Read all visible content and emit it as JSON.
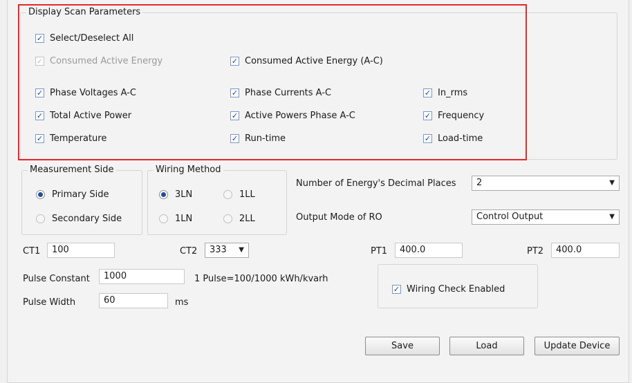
{
  "scan_params": {
    "title": "Display Scan Parameters",
    "select_all": "Select/Deselect All",
    "items": {
      "consumed_active_energy": "Consumed Active Energy",
      "consumed_active_energy_ac": "Consumed Active Energy (A-C)",
      "phase_voltages": "Phase Voltages A-C",
      "phase_currents": "Phase Currents A-C",
      "in_rms": "In_rms",
      "total_active_power": "Total Active Power",
      "active_powers_phase": "Active Powers Phase A-C",
      "frequency": "Frequency",
      "temperature": "Temperature",
      "run_time": "Run-time",
      "load_time": "Load-time"
    }
  },
  "measurement_side": {
    "title": "Measurement Side",
    "primary": "Primary Side",
    "secondary": "Secondary Side",
    "selected": "Primary Side"
  },
  "wiring_method": {
    "title": "Wiring Method",
    "options": [
      "3LN",
      "1LL",
      "1LN",
      "2LL"
    ],
    "selected": "3LN"
  },
  "energy_decimal": {
    "label": "Number of Energy's Decimal Places",
    "value": "2"
  },
  "output_mode": {
    "label": "Output Mode of RO",
    "value": "Control Output"
  },
  "ct1": {
    "label": "CT1",
    "value": "100"
  },
  "ct2": {
    "label": "CT2",
    "value": "333"
  },
  "pt1": {
    "label": "PT1",
    "value": "400.0"
  },
  "pt2": {
    "label": "PT2",
    "value": "400.0"
  },
  "pulse_constant": {
    "label": "Pulse Constant",
    "value": "1000",
    "note": "1 Pulse=100/1000 kWh/kvarh"
  },
  "pulse_width": {
    "label": "Pulse Width",
    "value": "60",
    "unit": "ms"
  },
  "wiring_check": {
    "label": "Wiring Check Enabled"
  },
  "buttons": {
    "save": "Save",
    "load": "Load",
    "update": "Update  Device"
  },
  "colors": {
    "highlight": "#e8262a",
    "radio_dot": "#244c9e",
    "check": "#23428a"
  }
}
